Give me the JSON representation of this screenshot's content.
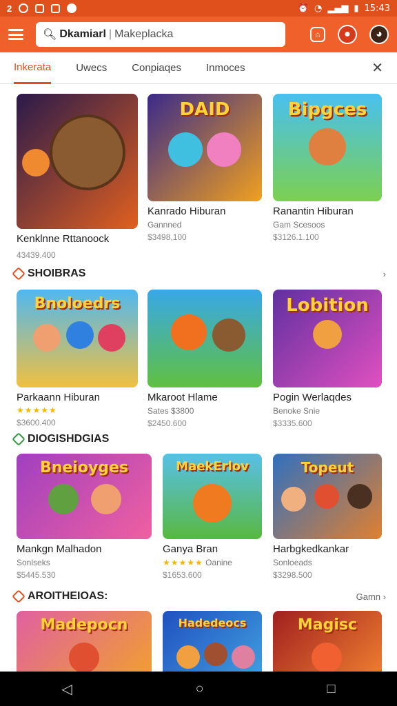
{
  "status": {
    "time": "15:43"
  },
  "search": {
    "bold_text": "Dkamiarl",
    "placeholder_text": "Makeplacka"
  },
  "tabs": [
    {
      "label": "Inkerata"
    },
    {
      "label": "Uwecs"
    },
    {
      "label": "Conpiaqes"
    },
    {
      "label": "Inmoces"
    }
  ],
  "sections": [
    {
      "title": "SHOIBRAS",
      "more": ""
    },
    {
      "title": "DIOGISHDGIAS",
      "more": ""
    },
    {
      "title": "AROITHEIOAS:",
      "more": "Gamn"
    }
  ],
  "row1": [
    {
      "name": "Kenklnne Rttanoock",
      "sub": "",
      "price": "43439.400",
      "colors": [
        "#2a1a4a",
        "#e06020"
      ],
      "art_title": ""
    },
    {
      "name": "Kanrado Hiburan",
      "sub": "Gannned",
      "price": "$3498,100",
      "colors": [
        "#3a2a8a",
        "#f0a020"
      ],
      "art_title": "DAID"
    },
    {
      "name": "Ranantin Hiburan",
      "sub": "Gam Scesoos",
      "price": "$3126.1.100",
      "colors": [
        "#48c0f0",
        "#7cd050"
      ],
      "art_title": "Bipgces"
    }
  ],
  "row2": [
    {
      "name": "Parkaann Hiburan",
      "sub": "",
      "price": "$3600.400",
      "stars": "★★★★★",
      "colors": [
        "#50b8f0",
        "#f0c040"
      ],
      "art_title": "Bnoloedrs"
    },
    {
      "name": "Mkaroot Hlame",
      "sub": "Sates $3800",
      "price": "$2450.600",
      "stars": "",
      "colors": [
        "#38a8e8",
        "#60c040"
      ],
      "art_title": ""
    },
    {
      "name": "Pogin Werlaqdes",
      "sub": "Benoke Snie",
      "price": "$3335.600",
      "stars": "",
      "colors": [
        "#6030a0",
        "#e050c0"
      ],
      "art_title": "Lobition"
    }
  ],
  "row3": [
    {
      "name": "Mankgn Malhadon",
      "sub": "Sonlseks",
      "price": "$5445.530",
      "stars": "",
      "colors": [
        "#a040c0",
        "#f060a0"
      ],
      "art_title": "Bneioyges"
    },
    {
      "name": "Ganya Bran",
      "sub": "Oanine",
      "price": "$1653.600",
      "stars": "★★★★★",
      "colors": [
        "#58c0e8",
        "#58b840"
      ],
      "art_title": "MaekErlov"
    },
    {
      "name": "Harbgkedkankar",
      "sub": "Sonloeads",
      "price": "$3298.500",
      "stars": "",
      "colors": [
        "#3070c0",
        "#e08030"
      ],
      "art_title": "Topeut"
    }
  ],
  "row4": [
    {
      "colors": [
        "#e060a0",
        "#f0a030"
      ],
      "art_title": "Madepocn"
    },
    {
      "colors": [
        "#2050c0",
        "#40a0e0"
      ],
      "art_title": "Hadedeocs"
    },
    {
      "colors": [
        "#a02020",
        "#f08030"
      ],
      "art_title": "Magisc"
    }
  ]
}
